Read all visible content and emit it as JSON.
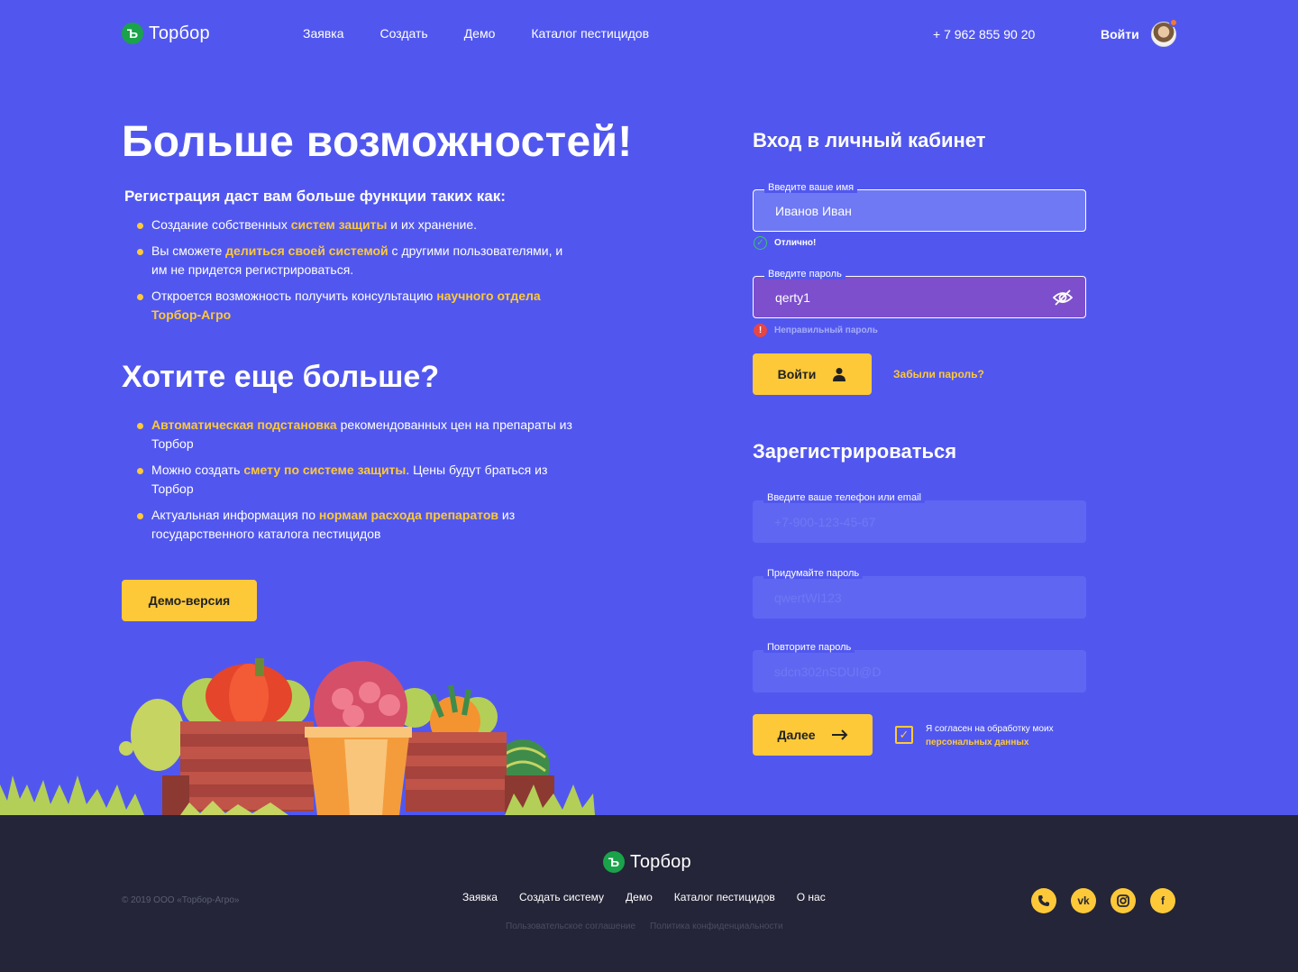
{
  "header": {
    "logo_text": "Торбор",
    "logo_mark": "Ъ",
    "nav": [
      "Заявка",
      "Создать",
      "Демо",
      "Каталог пестицидов"
    ],
    "phone": "+ 7 962 855 90 20",
    "login": "Войти"
  },
  "left": {
    "title": "Больше возможностей!",
    "subtitle": "Регистрация даст вам больше функции таких как:",
    "features": [
      {
        "pre": "Создание собственных ",
        "hl": "систем защиты",
        "post": " и их хранение."
      },
      {
        "pre": "Вы сможете ",
        "hl": "делиться своей системой",
        "post": " с другими пользователями, и им не придется регистрироваться."
      },
      {
        "pre": "Откроется возможность получить консультацию ",
        "hl": "научного отдела Торбор-Агро",
        "post": ""
      }
    ],
    "more_title": "Хотите еще больше?",
    "more_features": [
      {
        "pre": "",
        "hl": "Автоматическая подстановка",
        "post": " рекомендованных цен на препараты из Торбор"
      },
      {
        "pre": "Можно создать ",
        "hl": "смету по системе защиты",
        "post": ". Цены будут браться из Торбор"
      },
      {
        "pre": "Актуальная информация по ",
        "hl": "нормам расхода препаратов",
        "post": " из государственного каталога пестицидов"
      }
    ],
    "demo_button": "Демо-версия"
  },
  "login_form": {
    "title": "Вход в личный кабинет",
    "name_label": "Введите ваше имя",
    "name_value": "Иванов Иван",
    "name_ok": "Отлично!",
    "password_label": "Введите пароль",
    "password_value": "qerty1",
    "password_error": "Неправильный пароль",
    "submit": "Войти",
    "forgot": "Забыли пароль?"
  },
  "register_form": {
    "title": "Зарегистрироваться",
    "contact_label": "Введите ваше телефон или email",
    "contact_placeholder": "+7-900-123-45-67",
    "password_label": "Придумайте пароль",
    "password_placeholder": "qwertWI123",
    "repeat_label": "Повторите пароль",
    "repeat_placeholder": "sdcn302nSDUI@D",
    "submit": "Далее",
    "agree_text": "Я согласен на обработку моих",
    "agree_link": "персональных данных"
  },
  "footer": {
    "logo_text": "Торбор",
    "copyright": "© 2019 ООО «Торбор-Агро»",
    "nav": [
      "Заявка",
      "Создать систему",
      "Демо",
      "Каталог пестицидов",
      "О нас"
    ],
    "legal": [
      "Пользовательское соглашение",
      "Политика конфиденциальности"
    ],
    "socials": [
      "phone-icon",
      "vk-icon",
      "instagram-icon",
      "facebook-icon"
    ]
  },
  "colors": {
    "background": "#5157ee",
    "accent": "#fdc939",
    "footer": "#242538",
    "logo": "#1aa34a"
  }
}
